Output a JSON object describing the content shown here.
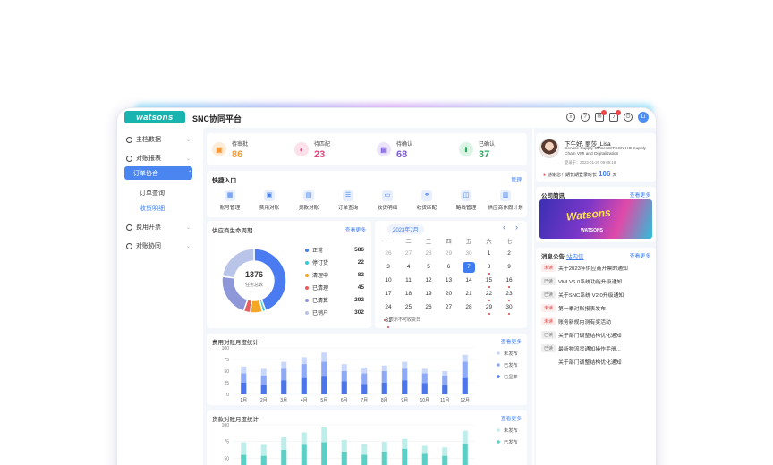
{
  "header": {
    "logo": "watsons",
    "title": "SNC协同平台",
    "badge_mail": "",
    "badge_bell": "",
    "user_initials": "Li"
  },
  "sidebar": {
    "items": [
      {
        "label": "主档数据"
      },
      {
        "label": "对账报表"
      },
      {
        "label": "订单协合"
      },
      {
        "label": "费用开票"
      },
      {
        "label": "对账协同"
      }
    ],
    "subitems": [
      {
        "label": "订单查询"
      },
      {
        "label": "收货明细"
      }
    ]
  },
  "stats": [
    {
      "label": "待审批",
      "value": "86",
      "color": "#f59a3a"
    },
    {
      "label": "待匹配",
      "value": "23",
      "color": "#e8457a"
    },
    {
      "label": "待确认",
      "value": "68",
      "color": "#7b5bd8"
    },
    {
      "label": "已确认",
      "value": "37",
      "color": "#2dad62"
    }
  ],
  "quick": {
    "title": "快捷入口",
    "manage": "管理",
    "items": [
      {
        "label": "账号管理"
      },
      {
        "label": "费用对账"
      },
      {
        "label": "货款对账"
      },
      {
        "label": "订单查询"
      },
      {
        "label": "收货明细"
      },
      {
        "label": "收货匹配"
      },
      {
        "label": "路线管理"
      },
      {
        "label": "供应商休假计划"
      }
    ]
  },
  "lifecycle": {
    "title": "供应商生命周期",
    "more": "查看更多",
    "total": "1376",
    "total_label": "任务总数",
    "legend": [
      {
        "label": "正常",
        "value": "586",
        "color": "#4b7bf0"
      },
      {
        "label": "停订货",
        "value": "22",
        "color": "#3ec6d6"
      },
      {
        "label": "清理中",
        "value": "82",
        "color": "#f5a623"
      },
      {
        "label": "已清理",
        "value": "45",
        "color": "#e85d5d"
      },
      {
        "label": "已清算",
        "value": "292",
        "color": "#8e98d8"
      },
      {
        "label": "已销户",
        "value": "302",
        "color": "#b8c4e8"
      }
    ]
  },
  "calendar": {
    "month": "2023年7月",
    "weekdays": [
      "一",
      "二",
      "三",
      "四",
      "五",
      "六",
      "七"
    ],
    "rows": [
      [
        "26",
        "27",
        "28",
        "29",
        "30",
        "1",
        "2"
      ],
      [
        "3",
        "4",
        "5",
        "6",
        "7",
        "8",
        "9"
      ],
      [
        "10",
        "11",
        "12",
        "13",
        "14",
        "15",
        "16"
      ],
      [
        "17",
        "18",
        "19",
        "20",
        "21",
        "22",
        "23"
      ],
      [
        "24",
        "25",
        "26",
        "27",
        "28",
        "29",
        "30"
      ],
      [
        "31",
        "",
        "",
        "",
        "",
        "",
        ""
      ]
    ],
    "note": "表示不可收货日"
  },
  "fee_chart": {
    "title": "费用对账月度统计",
    "more": "查看更多",
    "legend": [
      "未发布",
      "已发布",
      "已显率"
    ]
  },
  "loan_chart": {
    "title": "货款对账月度统计",
    "more": "查看更多",
    "legend": [
      "未发布",
      "已发布"
    ]
  },
  "chart_data": [
    {
      "type": "bar",
      "title": "费用对账月度统计",
      "categories": [
        "1月",
        "2月",
        "3月",
        "4月",
        "5月",
        "6月",
        "7月",
        "8月",
        "9月",
        "10月",
        "11月",
        "12月"
      ],
      "series": [
        {
          "name": "未发布",
          "values": [
            60,
            55,
            70,
            80,
            90,
            65,
            58,
            62,
            70,
            55,
            50,
            85
          ]
        },
        {
          "name": "已发布",
          "values": [
            45,
            40,
            55,
            65,
            70,
            50,
            45,
            50,
            55,
            45,
            40,
            70
          ]
        },
        {
          "name": "已显率",
          "values": [
            25,
            20,
            30,
            35,
            38,
            28,
            22,
            25,
            30,
            24,
            20,
            35
          ]
        }
      ],
      "ylim": [
        0,
        100
      ],
      "yticks": [
        "100",
        "75",
        "50",
        "25",
        "0"
      ]
    },
    {
      "type": "bar",
      "title": "货款对账月度统计",
      "categories": [
        "1月",
        "2月",
        "3月",
        "4月",
        "5月",
        "6月",
        "7月",
        "8月",
        "9月",
        "10月",
        "11月",
        "12月"
      ],
      "series": [
        {
          "name": "未发布",
          "values": [
            65,
            60,
            75,
            85,
            95,
            70,
            62,
            66,
            72,
            58,
            55,
            88
          ]
        },
        {
          "name": "已发布",
          "values": [
            40,
            38,
            50,
            60,
            65,
            45,
            40,
            46,
            52,
            42,
            38,
            62
          ]
        }
      ],
      "ylim": [
        0,
        100
      ],
      "yticks": [
        "100",
        "75",
        "50",
        "25"
      ]
    }
  ],
  "profile": {
    "greeting": "下午好, 丽莎_Lisa",
    "role": "Service Supply Officer\\WTCCN HO Supply Chain VMI and Digitalization",
    "login": "登录于：2023-01-20 09:09:18",
    "thanks": "感谢您！期长期登录时长",
    "hours": "106",
    "hours_unit": "天"
  },
  "announce": {
    "title": "公司简讯",
    "more": "查看更多",
    "banner": "WATSONS"
  },
  "messages": {
    "title": "消息公告",
    "tab2": "站内信",
    "more": "查看更多",
    "items": [
      {
        "tag": "未读",
        "text": "关于2023年供应商开票的通知",
        "status": "new"
      },
      {
        "tag": "已读",
        "text": "VMI V6.0系统功能升级通知",
        "status": "done"
      },
      {
        "tag": "已读",
        "text": "关于SNC系统 V2.0升级通知",
        "status": "done"
      },
      {
        "tag": "未读",
        "text": "第一季对账报表发布",
        "status": "new"
      },
      {
        "tag": "未读",
        "text": "账务新规内测有奖活动",
        "status": "new"
      },
      {
        "tag": "已读",
        "text": "关于部门调整结构优化通知",
        "status": "done"
      },
      {
        "tag": "已读",
        "text": "最新物流货通知操作手册...",
        "status": "done"
      },
      {
        "tag": "",
        "text": "关于部门调整结构优化通知",
        "status": "none"
      }
    ]
  }
}
